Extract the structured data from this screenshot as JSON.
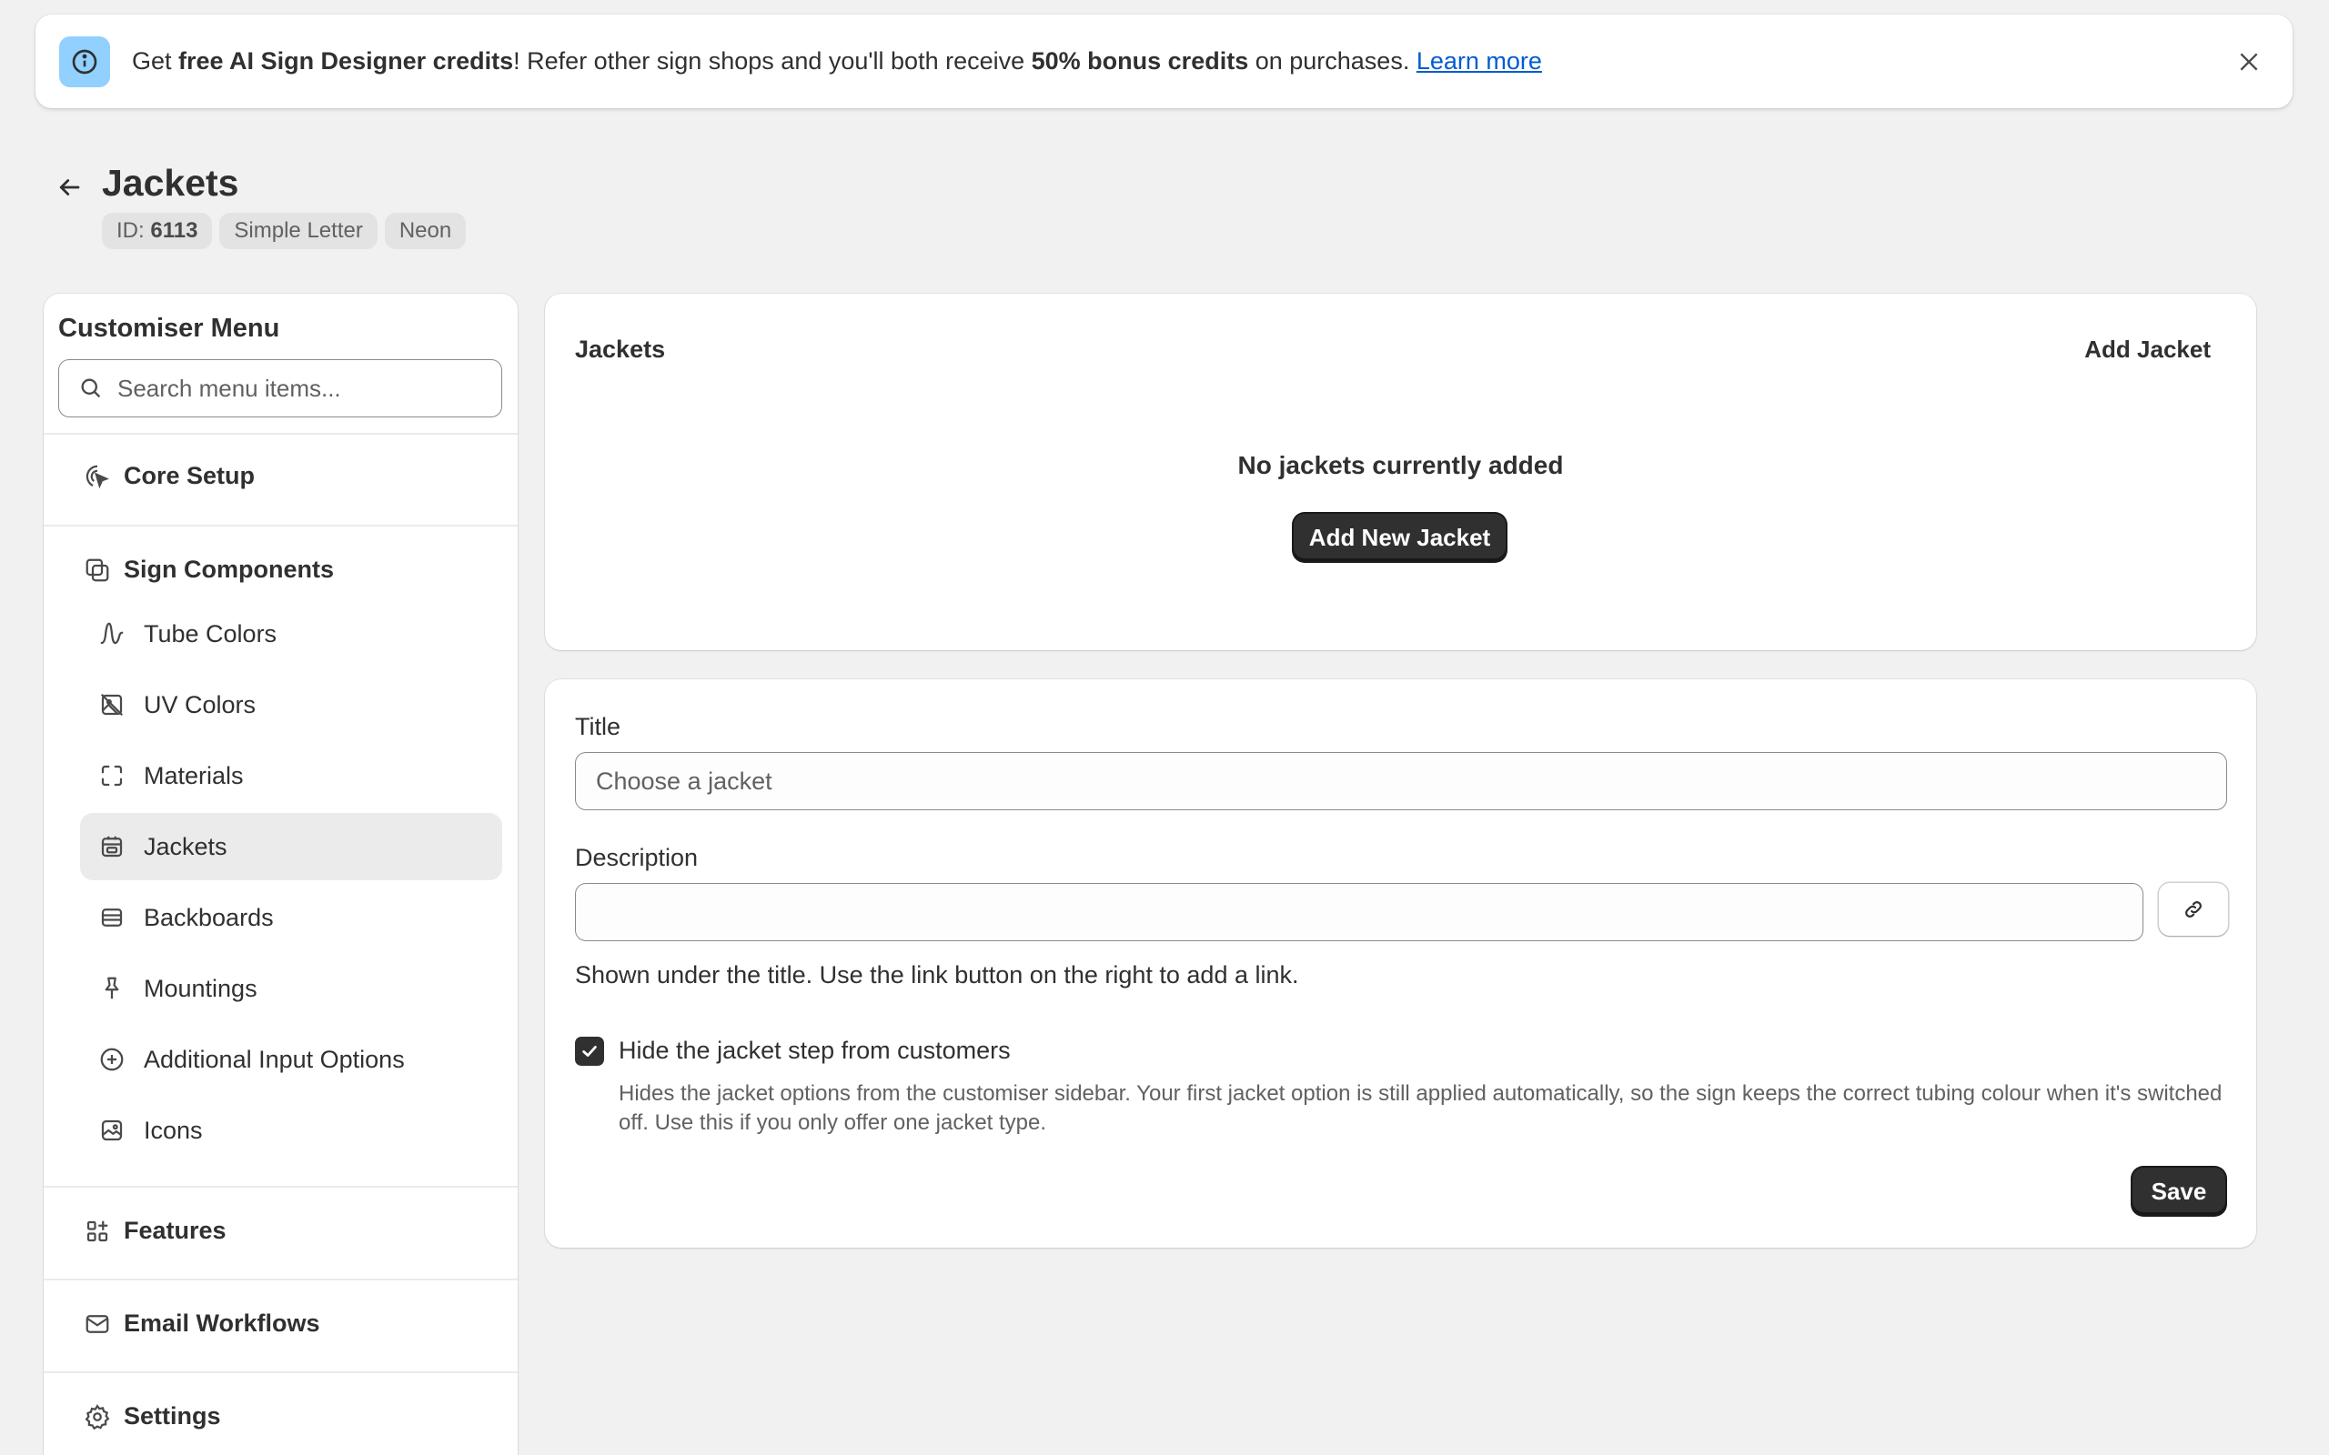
{
  "banner": {
    "pre": "Get ",
    "bold1": "free AI Sign Designer credits",
    "mid": "! Refer other sign shops and you'll both receive ",
    "bold2": "50% bonus credits",
    "post": " on purchases. ",
    "link": "Learn more"
  },
  "page": {
    "title": "Jackets",
    "tags": {
      "id_prefix": "ID: ",
      "id_value": "6113",
      "tag2": "Simple Letter",
      "tag3": "Neon"
    }
  },
  "sidebar": {
    "title": "Customiser Menu",
    "search_placeholder": "Search menu items...",
    "core_setup": "Core Setup",
    "sign_components": "Sign Components",
    "items": [
      "Tube Colors",
      "UV Colors",
      "Materials",
      "Jackets",
      "Backboards",
      "Mountings",
      "Additional Input Options",
      "Icons"
    ],
    "active_item": "Jackets",
    "features": "Features",
    "email_workflows": "Email Workflows",
    "settings": "Settings"
  },
  "jackets_card": {
    "title": "Jackets",
    "add_label": "Add Jacket",
    "empty_text": "No jackets currently added",
    "add_new_label": "Add New Jacket"
  },
  "form": {
    "title_label": "Title",
    "title_placeholder": "Choose a jacket",
    "title_value": "",
    "description_label": "Description",
    "description_value": "",
    "help_text": "Shown under the title. Use the link button on the right to add a link.",
    "hide_label": "Hide the jacket step from customers",
    "hide_checked": true,
    "hide_description": "Hides the jacket options from the customiser sidebar. Your first jacket option is still applied automatically, so the sign keeps the correct tubing colour when it's switched off. Use this if you only offer one jacket type.",
    "save_label": "Save"
  },
  "icons": {
    "banner": "info-icon",
    "close": "close-icon",
    "back": "arrow-left-icon",
    "search": "search-icon",
    "core_setup": "cursor-click-icon",
    "sign_components": "layers-icon",
    "tube_colors": "wave-icon",
    "uv_colors": "image-off-icon",
    "materials": "frame-corners-icon",
    "jackets": "calendar-box-icon",
    "backboards": "backboard-icon",
    "mountings": "pin-icon",
    "additional": "plus-circle-icon",
    "icons_item": "image-icon",
    "features": "apps-icon",
    "email": "mail-icon",
    "settings": "gear-icon",
    "link": "link-icon",
    "check": "check-icon"
  },
  "colors": {
    "background": "#f1f1f1",
    "banner_icon_bg": "#91d0ff",
    "link": "#005bd3",
    "primary_button": "#303030",
    "active_item_bg": "#ebebeb"
  }
}
